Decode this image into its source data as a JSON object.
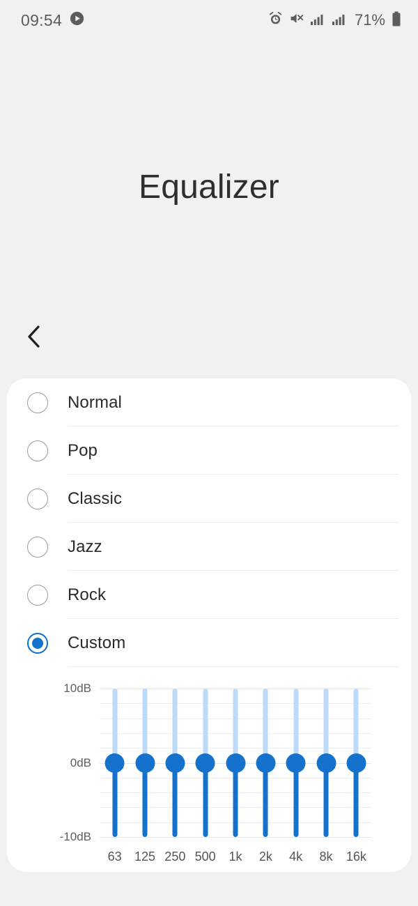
{
  "status_bar": {
    "time": "09:54",
    "battery_percent": "71%",
    "icons": [
      "play-circle-icon",
      "alarm-icon",
      "volume-mute-icon",
      "signal-bars-icon",
      "signal-bars-icon",
      "battery-icon"
    ]
  },
  "header": {
    "title": "Equalizer",
    "back_label": "Back"
  },
  "presets": {
    "items": [
      {
        "label": "Normal",
        "selected": false
      },
      {
        "label": "Pop",
        "selected": false
      },
      {
        "label": "Classic",
        "selected": false
      },
      {
        "label": "Jazz",
        "selected": false
      },
      {
        "label": "Rock",
        "selected": false
      },
      {
        "label": "Custom",
        "selected": true
      }
    ]
  },
  "equalizer": {
    "y_axis_labels": [
      "10dB",
      "0dB",
      "-10dB"
    ],
    "y_min": -10,
    "y_max": 10,
    "gridline_count": 11,
    "bands": [
      {
        "freq": "63",
        "value": 0
      },
      {
        "freq": "125",
        "value": 0
      },
      {
        "freq": "250",
        "value": 0
      },
      {
        "freq": "500",
        "value": 0
      },
      {
        "freq": "1k",
        "value": 0
      },
      {
        "freq": "2k",
        "value": 0
      },
      {
        "freq": "4k",
        "value": 0
      },
      {
        "freq": "8k",
        "value": 0
      },
      {
        "freq": "16k",
        "value": 0
      }
    ]
  },
  "colors": {
    "accent": "#1472cc",
    "track_inactive": "#bcdafa",
    "background": "#f1f1f1",
    "card": "#ffffff",
    "text": "#2b2b2b"
  }
}
